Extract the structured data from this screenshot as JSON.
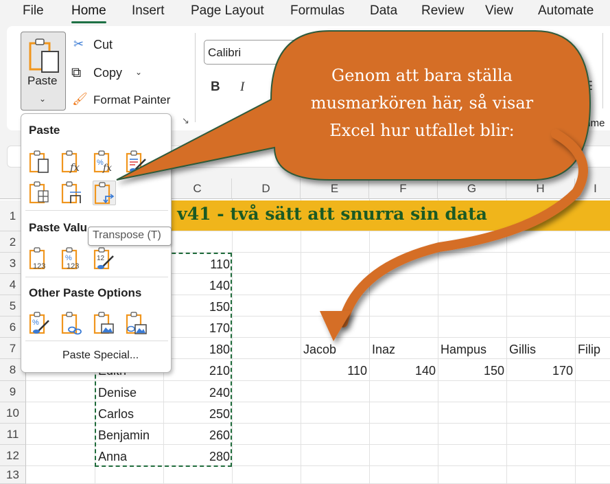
{
  "menubar": {
    "tabs": [
      "File",
      "Home",
      "Insert",
      "Page Layout",
      "Formulas",
      "Data",
      "Review",
      "View",
      "Automate"
    ],
    "active": "Home"
  },
  "ribbon": {
    "paste_label": "Paste",
    "cut_label": "Cut",
    "copy_label": "Copy",
    "format_painter_label": "Format Painter",
    "font_name": "Calibri",
    "bold_label": "B",
    "italic_label": "I",
    "alignment_partial": "gnme"
  },
  "paste_menu": {
    "section_paste": "Paste",
    "section_values": "Paste Valu",
    "section_other": "Other Paste Options",
    "paste_special": "Paste Special...",
    "tooltip": "Transpose (T)",
    "paste_icons": [
      "paste-icon",
      "paste-formulas-icon",
      "paste-formulas-number-format-icon",
      "keep-source-formatting-icon",
      "no-borders-icon",
      "keep-column-widths-icon",
      "transpose-icon"
    ],
    "value_icons": [
      "paste-values-icon",
      "values-number-format-icon",
      "values-source-formatting-icon"
    ],
    "other_icons": [
      "formatting-icon",
      "paste-link-icon",
      "picture-icon",
      "linked-picture-icon"
    ]
  },
  "callout": {
    "text_lines": [
      "Genom att bara ställa",
      "musmarkören här, så visar",
      "Excel hur utfallet blir:"
    ],
    "color": "#d56e27",
    "border_color": "#2e5a3a"
  },
  "sheet": {
    "columns": [
      "C",
      "D",
      "E",
      "F",
      "G",
      "H",
      "I"
    ],
    "rows": [
      "1",
      "2",
      "3",
      "4",
      "5",
      "6",
      "7",
      "8",
      "9",
      "10",
      "11",
      "12",
      "13"
    ],
    "title": "t v41 - två sätt att snurra sin data",
    "title_band_color": "#f0b51b",
    "names_col_b": [
      {
        "row": 8,
        "value": "Edith"
      },
      {
        "row": 9,
        "value": "Denise"
      },
      {
        "row": 10,
        "value": "Carlos"
      },
      {
        "row": 11,
        "value": "Benjamin"
      },
      {
        "row": 12,
        "value": "Anna"
      }
    ],
    "values_col_c": [
      {
        "row": 3,
        "value": "110"
      },
      {
        "row": 4,
        "value": "140"
      },
      {
        "row": 5,
        "value": "150"
      },
      {
        "row": 6,
        "value": "170"
      },
      {
        "row": 7,
        "value": "180"
      },
      {
        "row": 8,
        "value": "210"
      },
      {
        "row": 9,
        "value": "240"
      },
      {
        "row": 10,
        "value": "250"
      },
      {
        "row": 11,
        "value": "260"
      },
      {
        "row": 12,
        "value": "280"
      }
    ],
    "preview_row7": [
      "Jacob",
      "Inaz",
      "Hampus",
      "Gillis",
      "Filip"
    ],
    "preview_row8": [
      "110",
      "140",
      "150",
      "170"
    ]
  }
}
